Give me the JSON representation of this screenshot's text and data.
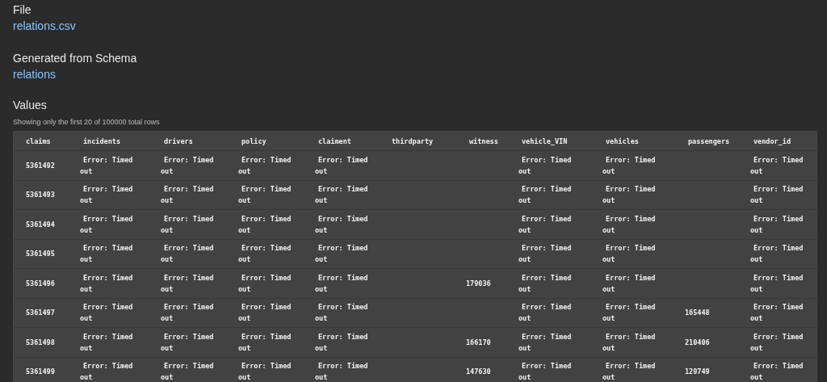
{
  "file": {
    "label": "File",
    "link": "relations.csv"
  },
  "schema": {
    "label": "Generated from Schema",
    "link": "relations"
  },
  "values": {
    "label": "Values",
    "caption": "Showing only the first 20 of 100000 total rows"
  },
  "table": {
    "columns": [
      "claims",
      "incidents",
      "drivers",
      "policy",
      "claiment",
      "thirdparty",
      "witness",
      "vehicle_VIN",
      "vehicles",
      "passengers",
      "vendor_id"
    ],
    "rows": [
      [
        "5361492",
        "Error: Timed out",
        "Error: Timed out",
        "Error: Timed out",
        "Error: Timed out",
        null,
        null,
        "Error: Timed out",
        "Error: Timed out",
        null,
        "Error: Timed out"
      ],
      [
        "5361493",
        "Error: Timed out",
        "Error: Timed out",
        "Error: Timed out",
        "Error: Timed out",
        null,
        null,
        "Error: Timed out",
        "Error: Timed out",
        null,
        "Error: Timed out"
      ],
      [
        "5361494",
        "Error: Timed out",
        "Error: Timed out",
        "Error: Timed out",
        "Error: Timed out",
        null,
        null,
        "Error: Timed out",
        "Error: Timed out",
        null,
        "Error: Timed out"
      ],
      [
        "5361495",
        "Error: Timed out",
        "Error: Timed out",
        "Error: Timed out",
        "Error: Timed out",
        null,
        null,
        "Error: Timed out",
        "Error: Timed out",
        null,
        "Error: Timed out"
      ],
      [
        "5361496",
        "Error: Timed out",
        "Error: Timed out",
        "Error: Timed out",
        "Error: Timed out",
        null,
        "179036",
        "Error: Timed out",
        "Error: Timed out",
        null,
        "Error: Timed out"
      ],
      [
        "5361497",
        "Error: Timed out",
        "Error: Timed out",
        "Error: Timed out",
        "Error: Timed out",
        null,
        null,
        "Error: Timed out",
        "Error: Timed out",
        "165448",
        "Error: Timed out"
      ],
      [
        "5361498",
        "Error: Timed out",
        "Error: Timed out",
        "Error: Timed out",
        "Error: Timed out",
        null,
        "166170",
        "Error: Timed out",
        "Error: Timed out",
        "210406",
        "Error: Timed out"
      ],
      [
        "5361499",
        "Error: Timed out",
        "Error: Timed out",
        "Error: Timed out",
        "Error: Timed out",
        null,
        "147630",
        "Error: Timed out",
        "Error: Timed out",
        "129749",
        "Error: Timed out"
      ]
    ]
  }
}
